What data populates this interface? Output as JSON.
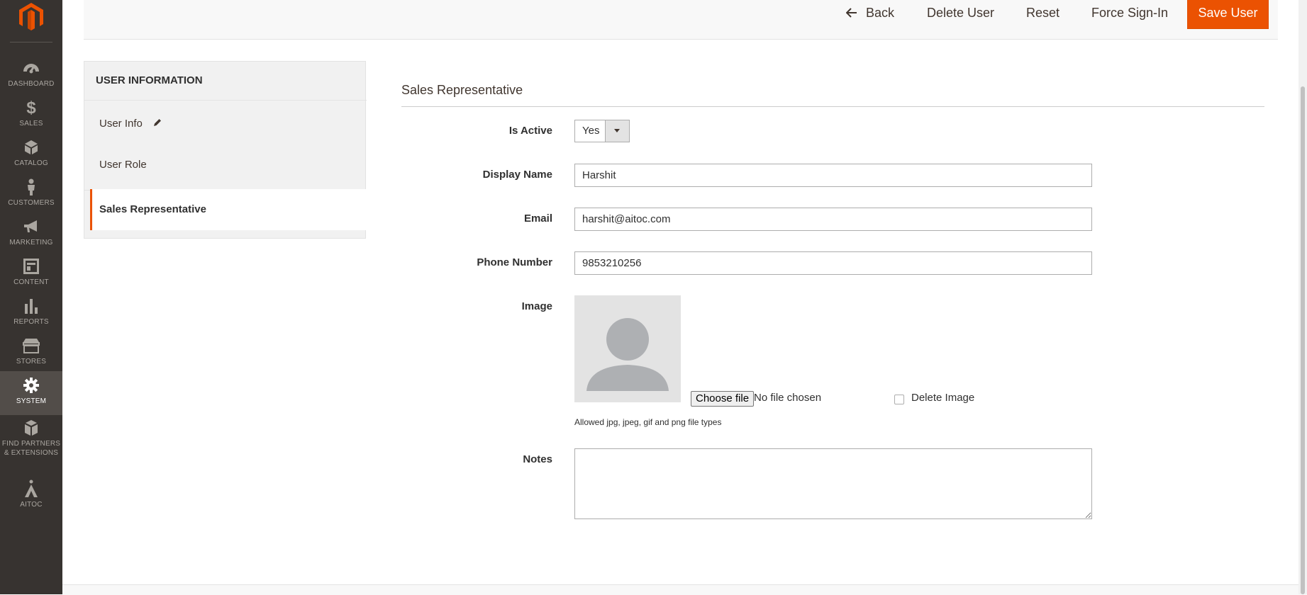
{
  "nav": {
    "items": [
      {
        "id": "dashboard",
        "label": "DASHBOARD",
        "icon": "dashboard-icon"
      },
      {
        "id": "sales",
        "label": "SALES",
        "icon": "dollar-icon"
      },
      {
        "id": "catalog",
        "label": "CATALOG",
        "icon": "box-icon"
      },
      {
        "id": "customers",
        "label": "CUSTOMERS",
        "icon": "person-icon"
      },
      {
        "id": "marketing",
        "label": "MARKETING",
        "icon": "megaphone-icon"
      },
      {
        "id": "content",
        "label": "CONTENT",
        "icon": "layout-icon"
      },
      {
        "id": "reports",
        "label": "REPORTS",
        "icon": "bar-chart-icon"
      },
      {
        "id": "stores",
        "label": "STORES",
        "icon": "storefront-icon"
      },
      {
        "id": "system",
        "label": "SYSTEM",
        "icon": "gear-icon",
        "active": true
      },
      {
        "id": "partners",
        "label": "FIND PARTNERS & EXTENSIONS",
        "icon": "cubes-icon"
      },
      {
        "id": "aitoc",
        "label": "AITOC",
        "icon": "aitoc-logo-icon"
      }
    ]
  },
  "header": {
    "back_label": "Back",
    "delete_label": "Delete User",
    "reset_label": "Reset",
    "force_signin_label": "Force Sign-In",
    "save_label": "Save User"
  },
  "sidebar": {
    "title": "USER INFORMATION",
    "tabs": [
      {
        "label": "User Info",
        "has_edit_icon": true
      },
      {
        "label": "User Role"
      },
      {
        "label": "Sales Representative",
        "active": true
      }
    ]
  },
  "form": {
    "section_title": "Sales Representative",
    "is_active": {
      "label": "Is Active",
      "value": "Yes"
    },
    "display_name": {
      "label": "Display Name",
      "value": "Harshit"
    },
    "email": {
      "label": "Email",
      "value": "harshit@aitoc.com"
    },
    "phone": {
      "label": "Phone Number",
      "value": "9853210256"
    },
    "image": {
      "label": "Image",
      "choose_file_label": "Choose file",
      "file_status": "No file chosen",
      "delete_label": "Delete Image",
      "delete_checked": false,
      "hint": "Allowed jpg, jpeg, gif and png file types"
    },
    "notes": {
      "label": "Notes",
      "value": ""
    }
  },
  "colors": {
    "accent": "#eb5202",
    "nav_bg": "#373330",
    "nav_active_bg": "#524d49"
  }
}
